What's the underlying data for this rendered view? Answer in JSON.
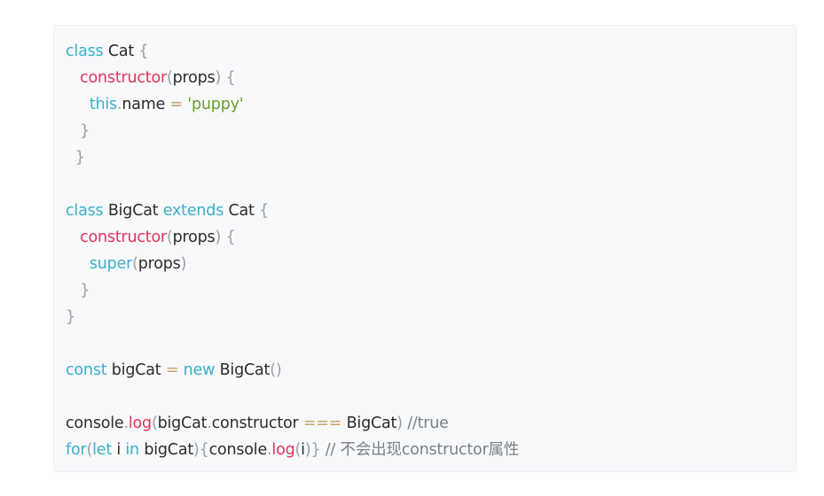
{
  "colors": {
    "background": "#f8f9fb",
    "keyword": "#3aafc9",
    "function": "#e2325b",
    "string": "#6b9e2a",
    "operator": "#c9a46a",
    "punctuation": "#9aa0a6",
    "comment": "#7a7f86",
    "text": "#2b2b2b"
  },
  "lines": [
    {
      "indent": "",
      "tokens": [
        {
          "t": "class",
          "c": "kw"
        },
        {
          "t": " Cat ",
          "c": "tx"
        },
        {
          "t": "{",
          "c": "pn"
        }
      ]
    },
    {
      "indent": "   ",
      "tokens": [
        {
          "t": "constructor",
          "c": "fn"
        },
        {
          "t": "(",
          "c": "pn"
        },
        {
          "t": "props",
          "c": "tx"
        },
        {
          "t": ")",
          "c": "pn"
        },
        {
          "t": " {",
          "c": "pn"
        }
      ]
    },
    {
      "indent": "     ",
      "tokens": [
        {
          "t": "this",
          "c": "kw"
        },
        {
          "t": ".",
          "c": "pn"
        },
        {
          "t": "name ",
          "c": "tx"
        },
        {
          "t": "=",
          "c": "op"
        },
        {
          "t": " 'puppy'",
          "c": "str"
        }
      ]
    },
    {
      "indent": "   ",
      "tokens": [
        {
          "t": "}",
          "c": "pn"
        }
      ]
    },
    {
      "indent": "  ",
      "tokens": [
        {
          "t": "}",
          "c": "pn"
        }
      ]
    },
    {
      "indent": "",
      "tokens": []
    },
    {
      "indent": "",
      "tokens": [
        {
          "t": "class",
          "c": "kw"
        },
        {
          "t": " BigCat ",
          "c": "tx"
        },
        {
          "t": "extends",
          "c": "kw"
        },
        {
          "t": " Cat ",
          "c": "tx"
        },
        {
          "t": "{",
          "c": "pn"
        }
      ]
    },
    {
      "indent": "   ",
      "tokens": [
        {
          "t": "constructor",
          "c": "fn"
        },
        {
          "t": "(",
          "c": "pn"
        },
        {
          "t": "props",
          "c": "tx"
        },
        {
          "t": ")",
          "c": "pn"
        },
        {
          "t": " {",
          "c": "pn"
        }
      ]
    },
    {
      "indent": "     ",
      "tokens": [
        {
          "t": "super",
          "c": "kw"
        },
        {
          "t": "(",
          "c": "pn"
        },
        {
          "t": "props",
          "c": "tx"
        },
        {
          "t": ")",
          "c": "pn"
        }
      ]
    },
    {
      "indent": "   ",
      "tokens": [
        {
          "t": "}",
          "c": "pn"
        }
      ]
    },
    {
      "indent": "",
      "tokens": [
        {
          "t": "}",
          "c": "pn"
        }
      ]
    },
    {
      "indent": "",
      "tokens": []
    },
    {
      "indent": "",
      "tokens": [
        {
          "t": "const",
          "c": "kw"
        },
        {
          "t": " bigCat ",
          "c": "tx"
        },
        {
          "t": "=",
          "c": "op"
        },
        {
          "t": " ",
          "c": "tx"
        },
        {
          "t": "new",
          "c": "kw"
        },
        {
          "t": " BigCat",
          "c": "tx"
        },
        {
          "t": "()",
          "c": "pn"
        }
      ]
    },
    {
      "indent": "",
      "tokens": []
    },
    {
      "indent": "",
      "tokens": [
        {
          "t": "console",
          "c": "tx"
        },
        {
          "t": ".",
          "c": "pn"
        },
        {
          "t": "log",
          "c": "fn"
        },
        {
          "t": "(",
          "c": "pn"
        },
        {
          "t": "bigCat",
          "c": "tx"
        },
        {
          "t": ".",
          "c": "pn"
        },
        {
          "t": "constructor ",
          "c": "tx"
        },
        {
          "t": "===",
          "c": "op"
        },
        {
          "t": " BigCat",
          "c": "tx"
        },
        {
          "t": ")",
          "c": "pn"
        },
        {
          "t": " //true",
          "c": "cm"
        }
      ]
    },
    {
      "indent": "",
      "tokens": [
        {
          "t": "for",
          "c": "kw"
        },
        {
          "t": "(",
          "c": "pn"
        },
        {
          "t": "let",
          "c": "kw"
        },
        {
          "t": " i ",
          "c": "tx"
        },
        {
          "t": "in",
          "c": "kw"
        },
        {
          "t": " bigCat",
          "c": "tx"
        },
        {
          "t": "){",
          "c": "pn"
        },
        {
          "t": "console",
          "c": "tx"
        },
        {
          "t": ".",
          "c": "pn"
        },
        {
          "t": "log",
          "c": "fn"
        },
        {
          "t": "(",
          "c": "pn"
        },
        {
          "t": "i",
          "c": "tx"
        },
        {
          "t": ")}",
          "c": "pn"
        },
        {
          "t": " // 不会出现constructor属性",
          "c": "cm"
        }
      ]
    }
  ]
}
